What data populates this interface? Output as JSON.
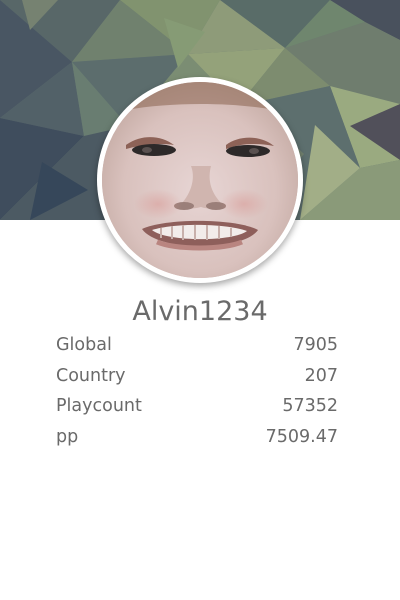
{
  "profile": {
    "username": "Alvin1234",
    "avatar_icon": "user-avatar-photo",
    "banner_icon": "low-poly-background"
  },
  "stats": [
    {
      "label": "Global",
      "value": "7905"
    },
    {
      "label": "Country",
      "value": "207"
    },
    {
      "label": "Playcount",
      "value": "57352"
    },
    {
      "label": "pp",
      "value": "7509.47"
    }
  ],
  "colors": {
    "text": "#6a6a6a",
    "background": "#ffffff",
    "banner_dark": "#4a5a63",
    "banner_light": "#9aa783"
  }
}
